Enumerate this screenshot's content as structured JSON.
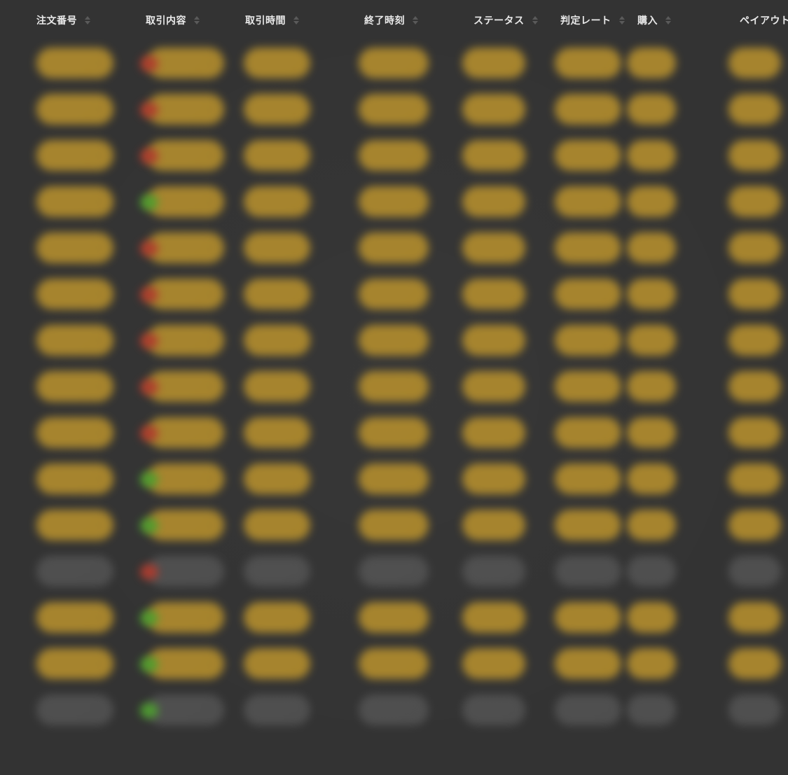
{
  "table": {
    "headers": [
      "注文番号",
      "取引内容",
      "取引時間",
      "終了時刻",
      "ステータス",
      "判定レート",
      "購入",
      "ペイアウト"
    ],
    "rows": [
      {
        "marker": "red",
        "color": "yellow"
      },
      {
        "marker": "red",
        "color": "yellow"
      },
      {
        "marker": "red",
        "color": "yellow"
      },
      {
        "marker": "green",
        "color": "yellow"
      },
      {
        "marker": "red",
        "color": "yellow"
      },
      {
        "marker": "red",
        "color": "yellow"
      },
      {
        "marker": "red",
        "color": "yellow"
      },
      {
        "marker": "red",
        "color": "yellow"
      },
      {
        "marker": "red",
        "color": "yellow"
      },
      {
        "marker": "green",
        "color": "yellow"
      },
      {
        "marker": "green",
        "color": "yellow"
      },
      {
        "marker": "red",
        "color": "gray"
      },
      {
        "marker": "green",
        "color": "yellow"
      },
      {
        "marker": "green",
        "color": "yellow"
      },
      {
        "marker": "green",
        "color": "gray"
      }
    ]
  },
  "colors": {
    "background": "#333333",
    "header_text": "#e9e9e9",
    "sort_icon": "#5a5a5a",
    "blurred_yellow": "#b8902a",
    "blurred_gray": "#5a5a5a",
    "marker_red": "#b23b2d",
    "marker_green": "#4ea12f"
  },
  "icons": {
    "sort": "sort-icon"
  }
}
